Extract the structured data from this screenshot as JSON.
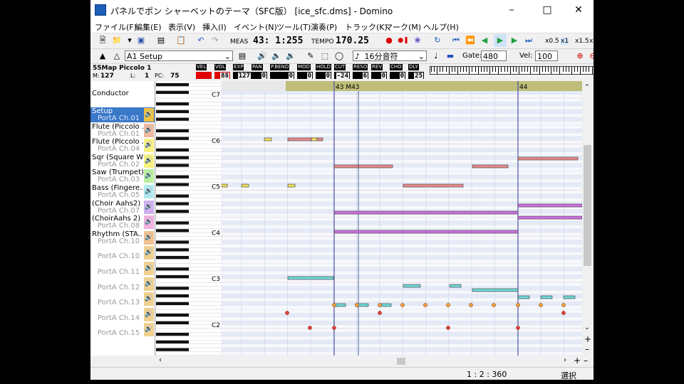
{
  "window": {
    "title": "パネルでポン シャーベットのテーマ（SFC版） [ice_sfc.dms] - Domino"
  },
  "menu": [
    "ファイル(F)",
    "編集(E)",
    "表示(V)",
    "挿入(I)",
    "イベント(N)",
    "ツール(T)",
    "演奏(P)",
    "トラック(K)",
    "マーク(M)",
    "ヘルプ(H)"
  ],
  "transport": {
    "meas_label": "MEAS",
    "position": "43: 1:255",
    "tempo_label": "TEMPO",
    "tempo": "170.25",
    "zoom": [
      "x0.5",
      "x1",
      "x1.5",
      "x"
    ]
  },
  "toolbar2": {
    "track_select": "A1 Setup",
    "snap": "16分音符",
    "gate_label": "Gate:",
    "gate": "480",
    "vel_label": "Vel:",
    "vel": "100"
  },
  "instrument": {
    "name": "55Map Piccolo 1",
    "m_label": "M:",
    "m_value": "127",
    "l_label": "L:",
    "l_value": "1",
    "pc_label": "PC:",
    "pc_value": "75"
  },
  "controls": [
    {
      "name": "VEL",
      "value": ""
    },
    {
      "name": "VOL",
      "value": "88"
    },
    {
      "name": "EXP",
      "value": "127"
    },
    {
      "name": "PAN",
      "value": "0"
    },
    {
      "name": "P.BEND",
      "value": "0"
    },
    {
      "name": "MOD",
      "value": "0"
    },
    {
      "name": "HOLD",
      "value": "0"
    },
    {
      "name": "CUT",
      "value": "-24"
    },
    {
      "name": "RESO",
      "value": "6"
    },
    {
      "name": "REV",
      "value": "0"
    },
    {
      "name": "CHO",
      "value": "0"
    },
    {
      "name": "DLY",
      "value": "25"
    }
  ],
  "tracks": [
    {
      "name": "Conductor",
      "port": "",
      "color": "#ffffff"
    },
    {
      "name": "Setup",
      "port": "PortA  Ch.01",
      "color": "#f0c040",
      "selected": true
    },
    {
      "name": "Flute (Piccolo ...",
      "port": "PortA  Ch.01",
      "color": "#f0b8a0"
    },
    {
      "name": "Flute (Piccolo ...",
      "port": "PortA  Ch.04",
      "color": "#f8f080"
    },
    {
      "name": "Sqr (Square W...",
      "port": "PortA  Ch.02",
      "color": "#f8f080"
    },
    {
      "name": "Saw (Trumpet)",
      "port": "PortA  Ch.03",
      "color": "#b8f0a0"
    },
    {
      "name": "Bass (Fingere...",
      "port": "PortA  Ch.05",
      "color": "#b0e8f0"
    },
    {
      "name": "(Choir Aahs2)",
      "port": "PortA  Ch.07",
      "color": "#d0b0f0"
    },
    {
      "name": "(ChoirAahs 2)",
      "port": "PortA  Ch.08",
      "color": "#f0b0e0"
    },
    {
      "name": "Rhythm (STA...",
      "port": "PortA  Ch.10",
      "color": "#f0c090"
    },
    {
      "name": "",
      "port": "PortA  Ch.10",
      "color": "#f0d090"
    },
    {
      "name": "",
      "port": "PortA  Ch.11",
      "color": "#f0d090"
    },
    {
      "name": "",
      "port": "PortA  Ch.12",
      "color": "#f0d090"
    },
    {
      "name": "",
      "port": "PortA  Ch.13",
      "color": "#f0d090"
    },
    {
      "name": "",
      "port": "PortA  Ch.14",
      "color": "#f0d090"
    },
    {
      "name": "",
      "port": "PortA  Ch.15",
      "color": "#f0d090"
    }
  ],
  "piano": {
    "octave_labels": [
      "C7",
      "C6",
      "C5",
      "C4",
      "C3",
      "C2"
    ]
  },
  "roll": {
    "measure_marks": [
      "43 M43",
      "44"
    ]
  },
  "status": {
    "position": "1 : 2 : 360",
    "mode": "選択"
  }
}
